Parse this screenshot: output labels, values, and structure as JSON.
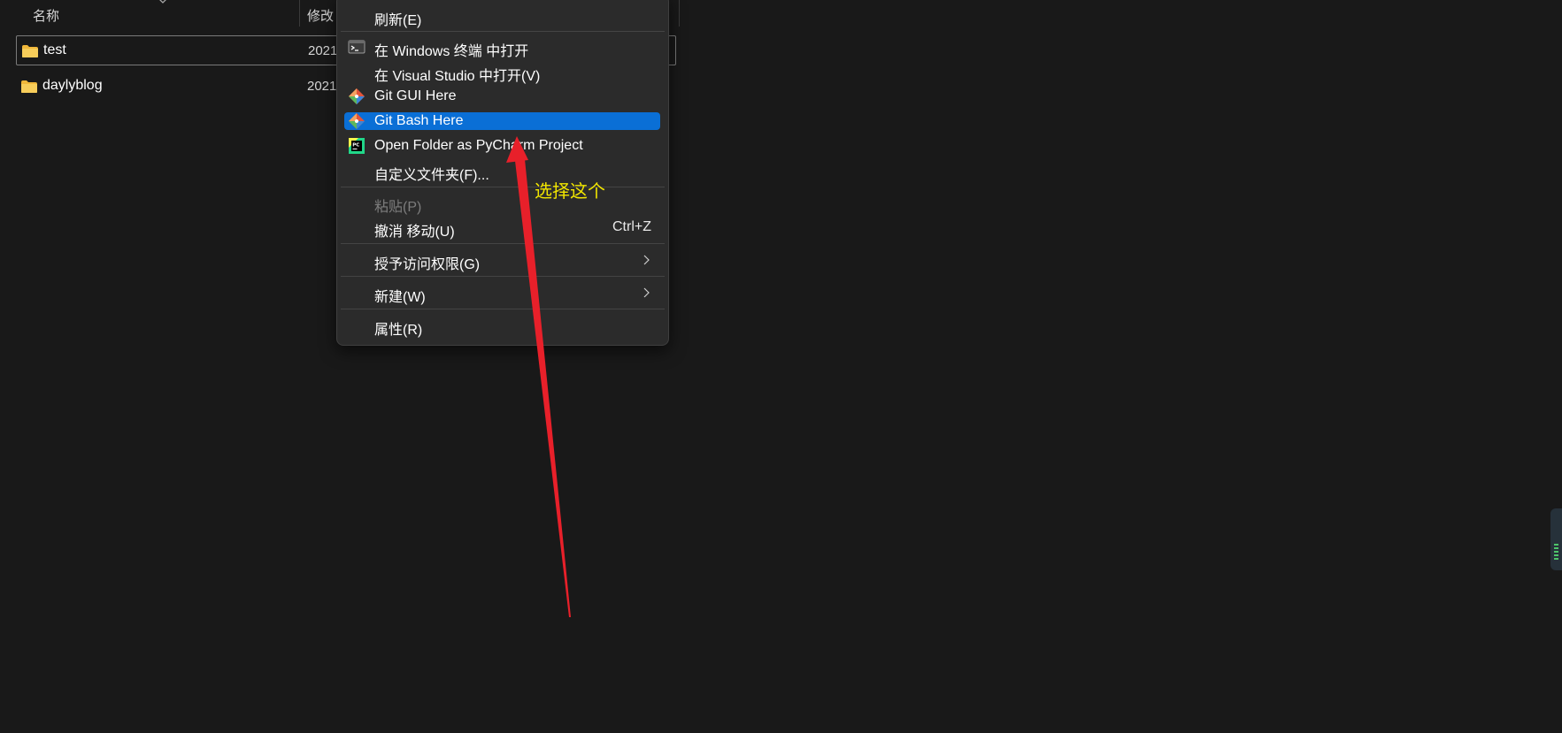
{
  "explorer": {
    "columns": {
      "name_header": "名称",
      "modified_header": "修改"
    },
    "files": [
      {
        "name": "test",
        "date": "2021",
        "selected": true
      },
      {
        "name": "daylyblog",
        "date": "2021",
        "selected": false
      }
    ]
  },
  "context_menu": {
    "items": [
      {
        "label": "刷新(E)",
        "icon": "none"
      },
      {
        "label": "在 Windows 终端 中打开",
        "icon": "terminal-icon"
      },
      {
        "label": "在 Visual Studio 中打开(V)",
        "icon": "none"
      },
      {
        "label": "Git GUI Here",
        "icon": "git-icon"
      },
      {
        "label": "Git Bash Here",
        "icon": "git-icon",
        "highlighted": true
      },
      {
        "label": "Open Folder as PyCharm Project",
        "icon": "pycharm-icon"
      },
      {
        "label": "自定义文件夹(F)...",
        "icon": "none"
      },
      {
        "label": "粘贴(P)",
        "icon": "none",
        "disabled": true
      },
      {
        "label": "撤消 移动(U)",
        "shortcut": "Ctrl+Z",
        "icon": "none"
      },
      {
        "label": "授予访问权限(G)",
        "icon": "none",
        "submenu": true
      },
      {
        "label": "新建(W)",
        "icon": "none",
        "submenu": true
      },
      {
        "label": "属性(R)",
        "icon": "none"
      }
    ]
  },
  "annotation": {
    "text": "选择这个",
    "color": "#f2e600",
    "arrow_color": "#e8202a"
  },
  "colors": {
    "background": "#191919",
    "menu_background": "#2b2b2b",
    "highlight": "#0a6fd6",
    "folder": "#f5c242"
  }
}
